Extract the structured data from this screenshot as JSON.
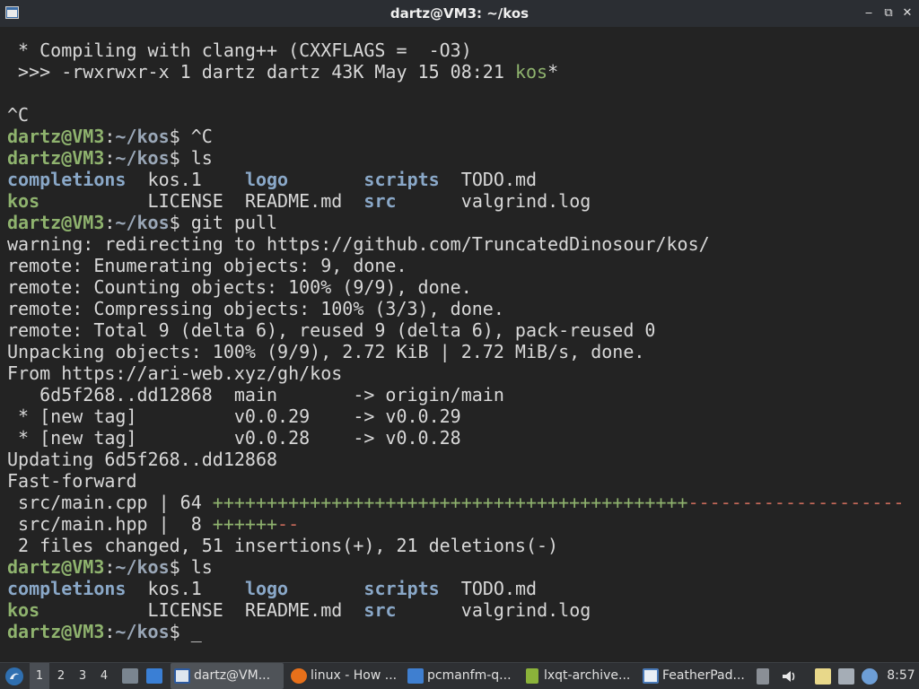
{
  "window": {
    "title": "dartz@VM3: ~/kos",
    "buttons": {
      "minimize": "‒",
      "maximize": "⧉",
      "close": "✕"
    }
  },
  "terminal": {
    "compile_line": " * Compiling with clang++ (CXXFLAGS =  -O3)",
    "build_line_pre": " >>> -rwxrwxr-x 1 dartz dartz 43K May 15 08:21 ",
    "build_line_exe": "kos",
    "build_line_star": "*",
    "interrupt": "^C",
    "prompt_user": "dartz@VM3",
    "prompt_sep": ":",
    "prompt_path": "~/kos",
    "prompt_dollar": "$ ",
    "cmd_ctrl_c": "^C",
    "cmd_ls": "ls",
    "cmd_git_pull": "git pull",
    "ls_row1": {
      "c1": "completions",
      "g1": "  ",
      "c2": "kos.1",
      "g2": "    ",
      "c3": "logo",
      "g3": "       ",
      "c4": "scripts",
      "g4": "  ",
      "c5": "TODO.md"
    },
    "ls_row2": {
      "c1": "kos",
      "g1": "          ",
      "c2": "LICENSE",
      "g2": "  ",
      "c3": "README.md",
      "g3": "  ",
      "c4": "src",
      "g4": "      ",
      "c5": "valgrind.log"
    },
    "git_output": [
      "warning: redirecting to https://github.com/TruncatedDinosour/kos/",
      "remote: Enumerating objects: 9, done.",
      "remote: Counting objects: 100% (9/9), done.",
      "remote: Compressing objects: 100% (3/3), done.",
      "remote: Total 9 (delta 6), reused 9 (delta 6), pack-reused 0",
      "Unpacking objects: 100% (9/9), 2.72 KiB | 2.72 MiB/s, done.",
      "From https://ari-web.xyz/gh/kos",
      "   6d5f268..dd12868  main       -> origin/main",
      " * [new tag]         v0.0.29    -> v0.0.29",
      " * [new tag]         v0.0.28    -> v0.0.28",
      "Updating 6d5f268..dd12868",
      "Fast-forward"
    ],
    "diff_main_label": " src/main.cpp | 64 ",
    "diff_main_plus": "++++++++++++++++++++++++++++++++++++++++++++",
    "diff_main_minus": "--------------------",
    "diff_hpp_label": " src/main.hpp |  8 ",
    "diff_hpp_plus": "++++++",
    "diff_hpp_minus": "--",
    "summary": " 2 files changed, 51 insertions(+), 21 deletions(-)",
    "cursor": "_"
  },
  "taskbar": {
    "workspaces": [
      "1",
      "2",
      "3",
      "4"
    ],
    "tasks": [
      {
        "label": "dartz@VM...",
        "icon": "terminal-icon",
        "color": "#2c5aa0"
      },
      {
        "label": "linux - How ...",
        "icon": "firefox-icon",
        "color": "#e8701a"
      },
      {
        "label": "pcmanfm-q...",
        "icon": "folder-icon",
        "color": "#3f7fd0"
      },
      {
        "label": "lxqt-archive...",
        "icon": "archive-icon",
        "color": "#8bb33a"
      },
      {
        "label": "FeatherPad...",
        "icon": "featherpad-icon",
        "color": "#4a7ab8"
      }
    ],
    "clock": "8:57"
  }
}
